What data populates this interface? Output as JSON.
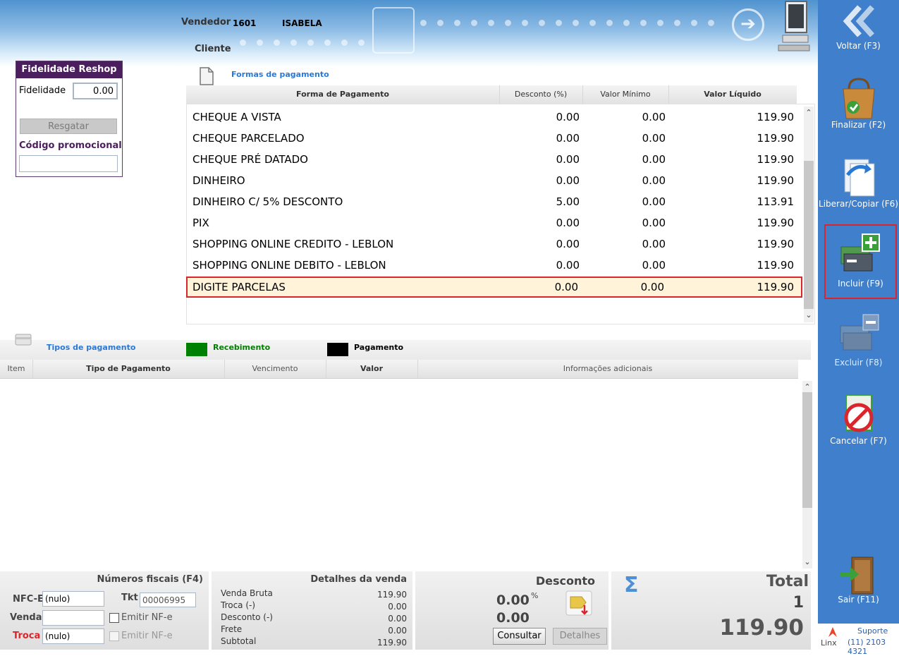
{
  "header": {
    "vendedor_label": "Vendedor",
    "vendedor_code": "1601",
    "vendedor_name": "ISABELA",
    "cliente_label": "Cliente"
  },
  "fidelidade": {
    "title": "Fidelidade Reshop",
    "field_label": "Fidelidade",
    "field_value": "0.00",
    "resgatar_label": "Resgatar",
    "promo_label": "Código promocional",
    "promo_value": ""
  },
  "formas": {
    "section_title": "Formas de pagamento",
    "columns": [
      "Forma de Pagamento",
      "Desconto (%)",
      "Valor Mínimo",
      "Valor Líquido"
    ],
    "rows": [
      {
        "nome": "CHEQUE A VISTA",
        "desconto": "0.00",
        "minimo": "0.00",
        "liquido": "119.90"
      },
      {
        "nome": "CHEQUE PARCELADO",
        "desconto": "0.00",
        "minimo": "0.00",
        "liquido": "119.90"
      },
      {
        "nome": "CHEQUE PRÉ DATADO",
        "desconto": "0.00",
        "minimo": "0.00",
        "liquido": "119.90"
      },
      {
        "nome": "DINHEIRO",
        "desconto": "0.00",
        "minimo": "0.00",
        "liquido": "119.90"
      },
      {
        "nome": "DINHEIRO C/ 5% DESCONTO",
        "desconto": "5.00",
        "minimo": "0.00",
        "liquido": "113.91"
      },
      {
        "nome": "PIX",
        "desconto": "0.00",
        "minimo": "0.00",
        "liquido": "119.90"
      },
      {
        "nome": "SHOPPING ONLINE CREDITO - LEBLON",
        "desconto": "0.00",
        "minimo": "0.00",
        "liquido": "119.90"
      },
      {
        "nome": "SHOPPING ONLINE DEBITO - LEBLON",
        "desconto": "0.00",
        "minimo": "0.00",
        "liquido": "119.90"
      },
      {
        "nome": "DIGITE PARCELAS",
        "desconto": "0.00",
        "minimo": "0.00",
        "liquido": "119.90"
      }
    ]
  },
  "tipos": {
    "section_title": "Tipos de pagamento",
    "legend_recebimento": "Recebimento",
    "legend_pagamento": "Pagamento",
    "recebimento_color": "#008000",
    "pagamento_color": "#000000",
    "columns": [
      "Item",
      "Tipo de Pagamento",
      "Vencimento",
      "Valor",
      "Informações adicionais"
    ]
  },
  "sidebar": {
    "voltar": "Voltar (F3)",
    "finalizar": "Finalizar (F2)",
    "liberar": "Liberar/Copiar (F6)",
    "incluir": "Incluir (F9)",
    "excluir": "Excluir (F8)",
    "cancelar": "Cancelar (F7)",
    "sair": "Sair (F11)",
    "suporte_label": "Suporte",
    "suporte_phone": "(11) 2103 4321",
    "brand": "Linx"
  },
  "fiscais": {
    "title": "Números fiscais (F4)",
    "nfce_label": "NFC-E",
    "nfce_value": "(nulo)",
    "tkt_label": "Tkt",
    "tkt_value": "00006995",
    "venda_label": "Venda",
    "venda_value": "",
    "emitir_label": "Emitir NF-e",
    "troca_label": "Troca",
    "troca_value": "(nulo)",
    "emitir2_label": "Emitir NF-e"
  },
  "detalhes": {
    "title": "Detalhes da venda",
    "items": [
      {
        "label": "Venda Bruta",
        "value": "119.90"
      },
      {
        "label": "Troca (-)",
        "value": "0.00"
      },
      {
        "label": "Desconto (-)",
        "value": "0.00"
      },
      {
        "label": "Frete",
        "value": "0.00"
      },
      {
        "label": "Subtotal",
        "value": "119.90"
      }
    ]
  },
  "desconto": {
    "title": "Desconto",
    "percent": "0.00",
    "percent_sign": "%",
    "value": "0.00",
    "consultar": "Consultar",
    "detalhes": "Detalhes"
  },
  "total": {
    "title": "Total",
    "quantity": "1",
    "value": "119.90",
    "sigma": "Σ"
  }
}
